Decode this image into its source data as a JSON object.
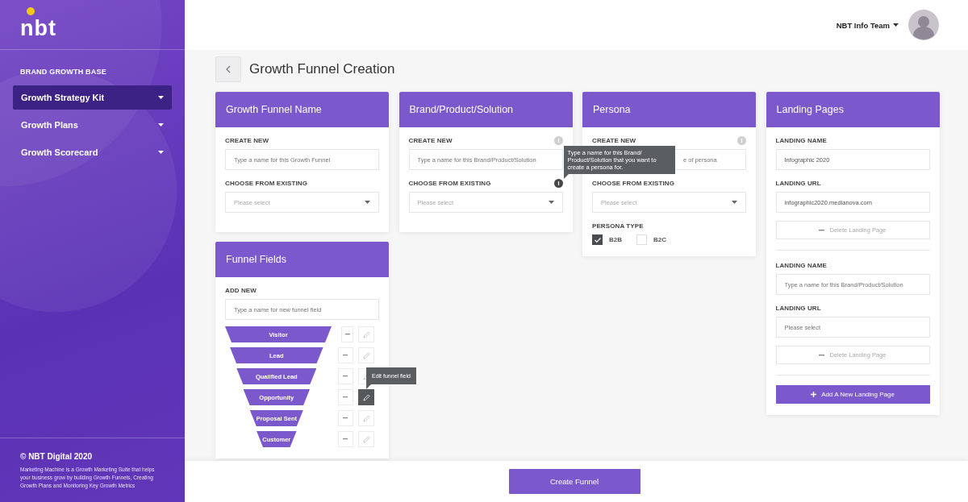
{
  "sidebar": {
    "logo": "nbt",
    "section": "BRAND GROWTH BASE",
    "items": [
      {
        "label": "Growth Strategy Kit",
        "selected": true
      },
      {
        "label": "Growth Plans",
        "selected": false
      },
      {
        "label": "Growth Scorecard",
        "selected": false
      }
    ],
    "copyright": "© NBT Digital 2020",
    "description": "Marketing Machine is a Growth Marketing Suite that helps your business grow by building Growth Funnels, Creating Growth Plans and Monitoring Key Growth Metrics"
  },
  "header": {
    "user": "NBT Info Team"
  },
  "page": {
    "title": "Growth Funnel Creation"
  },
  "funnel_name_card": {
    "title": "Growth Funnel Name",
    "fields": [
      {
        "label": "CREATE NEW",
        "kind": "text",
        "placeholder": "Type a name for this Growth Funnel",
        "info_icon": false
      },
      {
        "label": "CHOOSE FROM EXISTING",
        "kind": "select",
        "placeholder": "Please select",
        "info_icon": false
      }
    ]
  },
  "brand_card": {
    "title": "Brand/Product/Solution",
    "fields": [
      {
        "label": "CREATE NEW",
        "kind": "text",
        "placeholder": "Type a name for this Brand/Product/Solution",
        "info_icon": true,
        "info_active": false
      },
      {
        "label": "CHOOSE FROM EXISTING",
        "kind": "select",
        "placeholder": "Please select",
        "info_icon": true,
        "info_active": true,
        "tooltip": "Type a name for this Brand/ Product/Solution that you want to create a persona for."
      }
    ]
  },
  "persona_card": {
    "title": "Persona",
    "fields": [
      {
        "label": "CREATE NEW",
        "kind": "text",
        "placeholder": "e of persona",
        "info_icon": true,
        "info_active": false
      },
      {
        "label": "CHOOSE FROM EXISTING",
        "kind": "select",
        "placeholder": "Please select",
        "info_icon": false
      }
    ],
    "type_label": "PERSONA TYPE",
    "types": [
      {
        "label": "B2B",
        "checked": true
      },
      {
        "label": "B2C",
        "checked": false
      }
    ]
  },
  "landing_pages_card": {
    "title": "Landing Pages",
    "entries": [
      {
        "fields": [
          {
            "label": "LANDING NAME",
            "value": "Infographic 2020"
          },
          {
            "label": "LANDING URL",
            "value": "infographic2020.medianova.com"
          }
        ],
        "delete_label": "Delete Landing Page"
      },
      {
        "fields": [
          {
            "label": "LANDING NAME",
            "placeholder": "Type a name for this Brand/Product/Solution"
          },
          {
            "label": "LANDING URL",
            "placeholder": "Please select"
          }
        ],
        "delete_label": "Delete Landing Page"
      }
    ],
    "add_label": "Add A New Landing Page"
  },
  "funnel_fields_card": {
    "title": "Funnel Fields",
    "add_label": "ADD NEW",
    "placeholder": "Type a name for new funnel field",
    "tooltip": "Edit funnel field",
    "stages": [
      {
        "label": "Visitor",
        "hovered": false
      },
      {
        "label": "Lead",
        "hovered": false
      },
      {
        "label": "Qualified Lead",
        "hovered": false
      },
      {
        "label": "Opportunity",
        "hovered": true
      },
      {
        "label": "Proposal Sent",
        "hovered": false
      },
      {
        "label": "Customer",
        "hovered": false
      }
    ]
  },
  "footer": {
    "create_button": "Create Funnel"
  }
}
